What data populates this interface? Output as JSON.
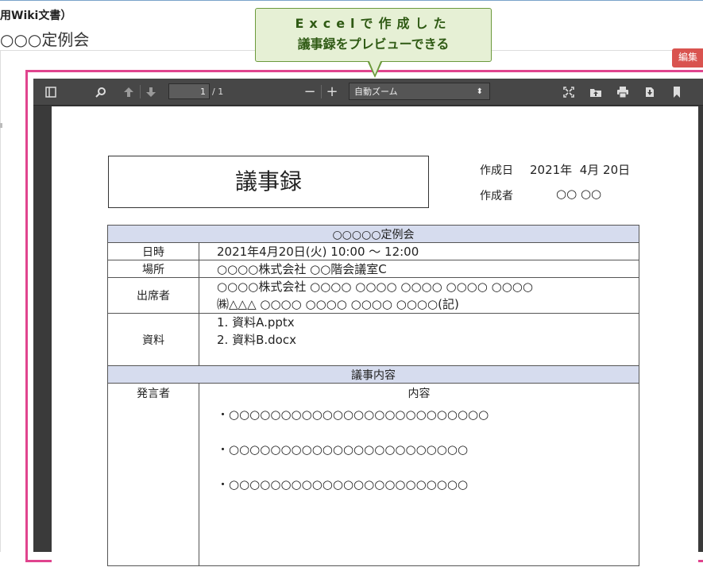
{
  "header": {
    "breadcrumb": "用Wiki文書）",
    "page_title": "○○○定例会",
    "edit_button": "編集"
  },
  "callout": {
    "line1": "Excelで作成した",
    "line2": "議事録をプレビューできる"
  },
  "viewer": {
    "page_current": "1",
    "page_count": "/ 1",
    "zoom_label": "自動ズーム",
    "icons": [
      "sidebar-toggle-icon",
      "search-icon",
      "previous-page-icon",
      "next-page-icon",
      "zoom-out-icon",
      "zoom-in-icon",
      "presentation-mode-icon",
      "open-file-icon",
      "print-icon",
      "download-icon",
      "bookmark-icon"
    ]
  },
  "document": {
    "title": "議事録",
    "created_date_label": "作成日",
    "created_date": "2021年  4月 20日",
    "author_label": "作成者",
    "author": "○○ ○○",
    "meeting_header": "○○○○○定例会",
    "rows": {
      "datetime_label": "日時",
      "datetime_value": "2021年4月20日(火)  10:00 ～ 12:00",
      "place_label": "場所",
      "place_value": "○○○○株式会社  ○○階会議室C",
      "attendees_label": "出席者",
      "attendees_line1": "○○○○株式会社  ○○○○  ○○○○  ○○○○  ○○○○  ○○○○",
      "attendees_line2": "㈱△△△  ○○○○  ○○○○  ○○○○  ○○○○(記)",
      "materials_label": "資料",
      "material_1": "1. 資料A.pptx",
      "material_2": "2. 資料B.docx"
    },
    "discussion_header": "議事内容",
    "speaker_col": "発言者",
    "content_col": "内容",
    "items": [
      "・○○○○○○○○○○○○○○○○○○○○○○○○○",
      "・○○○○○○○○○○○○○○○○○○○○○○○",
      "・○○○○○○○○○○○○○○○○○○○○○○○"
    ]
  },
  "colors": {
    "frame": "#e0448e",
    "callout_bg": "#e6f0d5",
    "table_header": "#d6dcee",
    "edit_button": "#d9534f"
  }
}
